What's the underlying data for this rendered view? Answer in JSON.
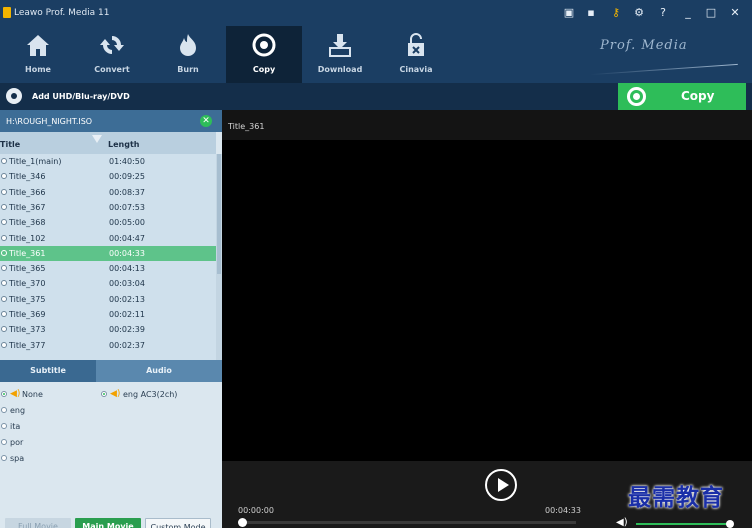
{
  "window": {
    "title": "Leawo Prof. Media 11"
  },
  "titlebar_icons": [
    "monitor-icon",
    "chat-icon",
    "key-icon",
    "gear-icon",
    "help-icon",
    "minimize-icon",
    "maximize-icon",
    "close-icon"
  ],
  "nav": {
    "items": [
      {
        "label": "Home",
        "icon": "home-icon"
      },
      {
        "label": "Convert",
        "icon": "convert-icon"
      },
      {
        "label": "Burn",
        "icon": "burn-icon"
      },
      {
        "label": "Copy",
        "icon": "copy-disc-icon",
        "active": true
      },
      {
        "label": "Download",
        "icon": "download-icon"
      },
      {
        "label": "Cinavia",
        "icon": "cinavia-icon"
      }
    ],
    "brand": "Prof. Media"
  },
  "toolbar": {
    "add_label": "Add UHD/Blu-ray/DVD",
    "copy_label": "Copy"
  },
  "source": {
    "path": "H:\\ROUGH_NIGHT.ISO"
  },
  "title_list": {
    "headers": {
      "title": "Title",
      "length": "Length"
    },
    "rows": [
      {
        "title": "Title_1(main)",
        "length": "01:40:50"
      },
      {
        "title": "Title_346",
        "length": "00:09:25"
      },
      {
        "title": "Title_366",
        "length": "00:08:37"
      },
      {
        "title": "Title_367",
        "length": "00:07:53"
      },
      {
        "title": "Title_368",
        "length": "00:05:00"
      },
      {
        "title": "Title_102",
        "length": "00:04:47"
      },
      {
        "title": "Title_361",
        "length": "00:04:33",
        "selected": true
      },
      {
        "title": "Title_365",
        "length": "00:04:13"
      },
      {
        "title": "Title_370",
        "length": "00:03:04"
      },
      {
        "title": "Title_375",
        "length": "00:02:13"
      },
      {
        "title": "Title_369",
        "length": "00:02:11"
      },
      {
        "title": "Title_373",
        "length": "00:02:39"
      },
      {
        "title": "Title_377",
        "length": "00:02:37"
      }
    ]
  },
  "tracks": {
    "subtitle_tab": "Subtitle",
    "audio_tab": "Audio",
    "subtitles": [
      "None",
      "eng",
      "ita",
      "por",
      "spa"
    ],
    "audio": [
      "eng AC3(2ch)"
    ]
  },
  "modes": {
    "full": "Full Movie",
    "main": "Main Movie",
    "custom": "Custom Mode"
  },
  "preview": {
    "title": "Title_361",
    "current_time": "00:00:00",
    "total_time": "00:04:33",
    "progress": 0.0,
    "volume": 0.95
  },
  "watermark": "最需教育",
  "colors": {
    "accent_green": "#2ebd59",
    "nav_blue": "#1b3e63",
    "selected_row": "#5ec38a"
  }
}
